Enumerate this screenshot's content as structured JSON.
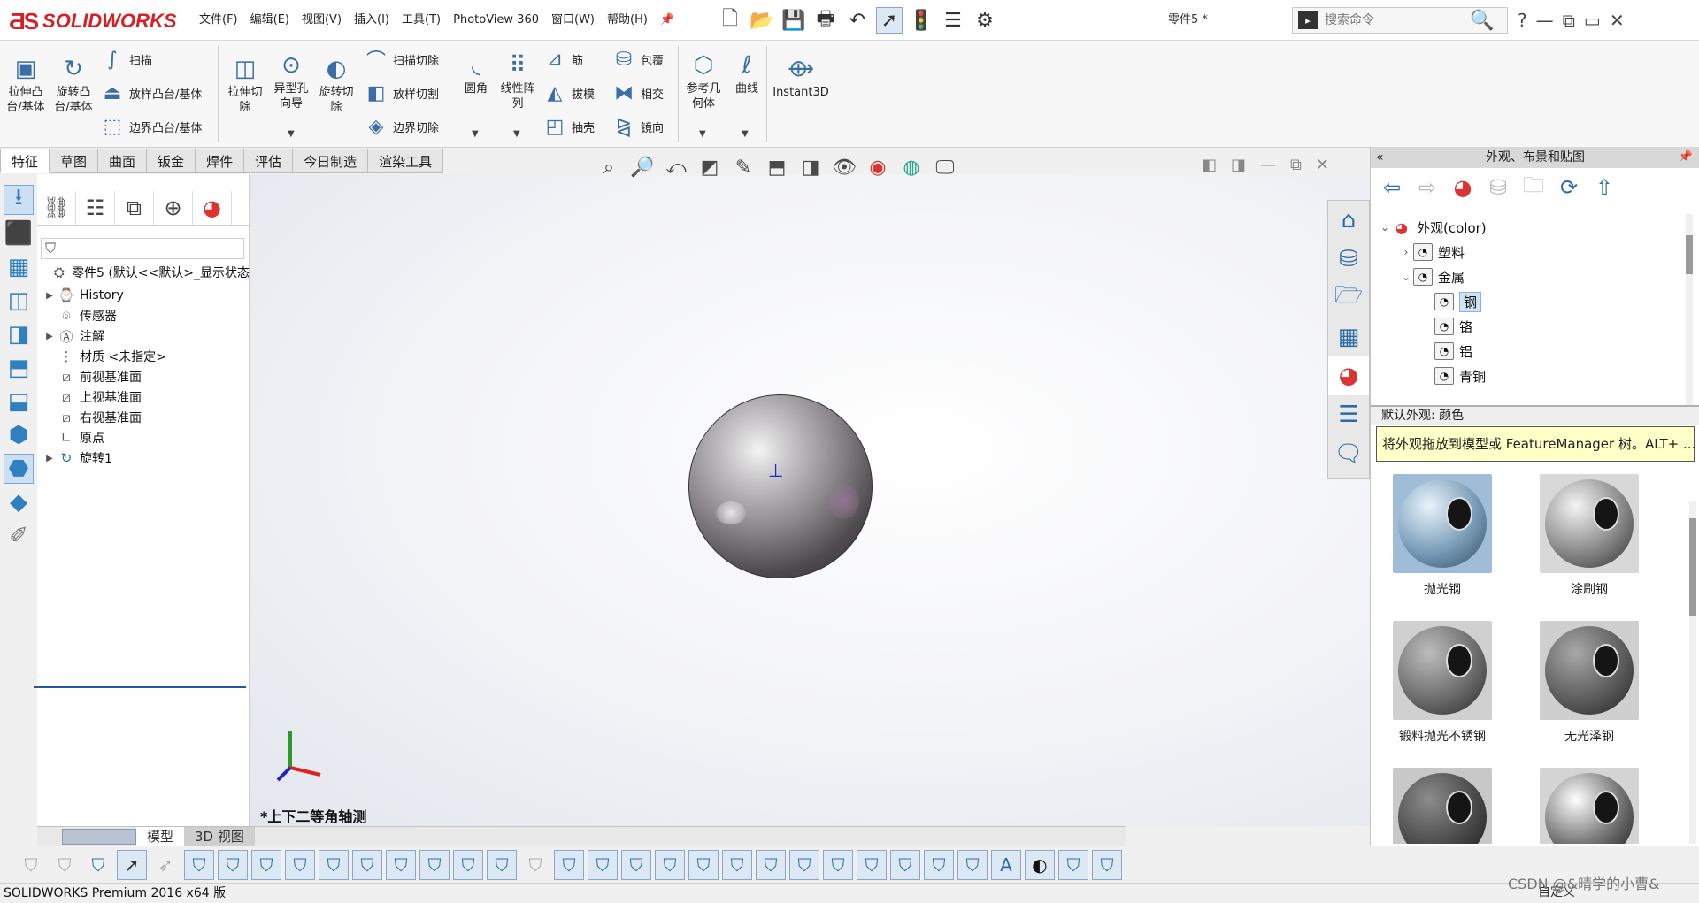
{
  "app": {
    "logo_text": "SOLIDWORKS",
    "doc_title": "零件5 *"
  },
  "menu": [
    "文件(F)",
    "编辑(E)",
    "视图(V)",
    "插入(I)",
    "工具(T)",
    "PhotoView 360",
    "窗口(W)",
    "帮助(H)"
  ],
  "search": {
    "placeholder": "搜索命令"
  },
  "ribbon": {
    "extrude_boss": "拉伸凸台/基体",
    "revolve_boss": "旋转凸台/基体",
    "sweep": "扫描",
    "loft_boss": "放样凸台/基体",
    "boundary_boss": "边界凸台/基体",
    "extrude_cut": "拉伸切除",
    "hole_wizard": "异型孔向导",
    "revolve_cut": "旋转切除",
    "swept_cut": "扫描切除",
    "lofted_cut": "放样切割",
    "boundary_cut": "边界切除",
    "fillet": "圆角",
    "linear_pattern": "线性阵列",
    "rib": "筋",
    "draft": "拔模",
    "shell": "抽壳",
    "wrap": "包覆",
    "intersect": "相交",
    "mirror": "镜向",
    "ref_geometry": "参考几何体",
    "curves": "曲线",
    "instant3d": "Instant3D"
  },
  "tabs": [
    "特征",
    "草图",
    "曲面",
    "钣金",
    "焊件",
    "评估",
    "今日制造",
    "渲染工具"
  ],
  "feature_tree": {
    "root": "零件5  (默认<<默认>_显示状态",
    "items": [
      {
        "label": "History",
        "icon": "history-icon",
        "expandable": true
      },
      {
        "label": "传感器",
        "icon": "sensor-icon",
        "expandable": false
      },
      {
        "label": "注解",
        "icon": "annotation-icon",
        "expandable": true
      },
      {
        "label": "材质 <未指定>",
        "icon": "material-icon",
        "expandable": false
      },
      {
        "label": "前视基准面",
        "icon": "plane-icon",
        "expandable": false
      },
      {
        "label": "上视基准面",
        "icon": "plane-icon",
        "expandable": false
      },
      {
        "label": "右视基准面",
        "icon": "plane-icon",
        "expandable": false
      },
      {
        "label": "原点",
        "icon": "origin-icon",
        "expandable": false
      },
      {
        "label": "旋转1",
        "icon": "revolve-icon",
        "expandable": true
      }
    ]
  },
  "viewport": {
    "view_name": "*上下二等角轴测"
  },
  "bottom_tabs": [
    "模型",
    "3D 视图"
  ],
  "status": {
    "text": "SOLIDWORKS Premium 2016 x64 版",
    "right": "自定义",
    "watermark": "CSDN @&晴学的小曹&"
  },
  "appearance_pane": {
    "title": "外观、布景和贴图",
    "tree": [
      {
        "label": "外观(color)",
        "level": 0,
        "expanded": true
      },
      {
        "label": "塑料",
        "level": 1,
        "expanded": false
      },
      {
        "label": "金属",
        "level": 1,
        "expanded": true
      },
      {
        "label": "钢",
        "level": 2,
        "selected": true
      },
      {
        "label": "铬",
        "level": 2
      },
      {
        "label": "铝",
        "level": 2
      },
      {
        "label": "青铜",
        "level": 2
      }
    ],
    "description": "默认外观: 颜色",
    "tooltip": "将外观拖放到模型或 FeatureManager 树。ALT+ ...",
    "swatches": [
      {
        "label": "抛光钢",
        "color": "#7a9cb8"
      },
      {
        "label": "涂刷钢",
        "color": "#8a8a8a"
      },
      {
        "label": "锻料抛光不锈钢",
        "color": "#6e6e6e"
      },
      {
        "label": "无光泽钢",
        "color": "#5e5e5e"
      },
      {
        "label": "",
        "color": "#4a4a4a"
      },
      {
        "label": "",
        "color": "#7c7c7c"
      }
    ]
  }
}
